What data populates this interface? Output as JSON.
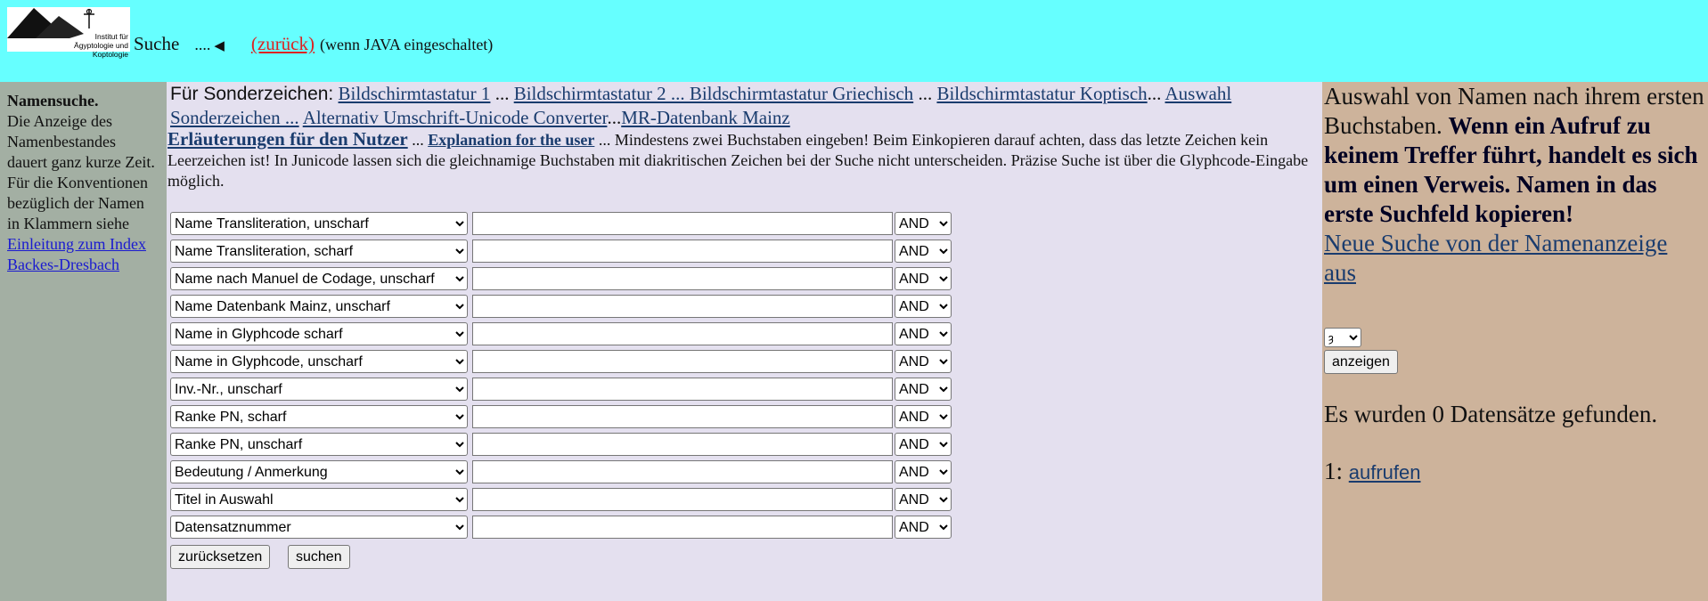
{
  "header": {
    "logo_text_line1": "Institut für",
    "logo_text_line2": "Ägyptologie und Koptologie",
    "title": "Suche",
    "dots": "....",
    "back_label": "(zurück)",
    "java_hint": "(wenn JAVA eingeschaltet)"
  },
  "sidebar": {
    "heading": "Namensuche.",
    "text1": "Die Anzeige des Namenbestandes dauert ganz kurze Zeit.",
    "text2": "Für die Konventionen bezüglich der Namen in Klammern siehe",
    "link": "Einleitung zum Index Backes-Dresbach"
  },
  "special_chars": {
    "label": "Für Sonderzeichen:",
    "links": [
      "Bildschirmtastatur 1",
      "Bildschirmtastatur 2 ... Bildschirmtastatur Griechisch",
      "Bildschirmtastatur Koptisch",
      "Auswahl Sonderzeichen ...",
      "Alternativ Umschrift-Unicode Converter",
      "MR-Datenbank Mainz"
    ],
    "sep1": "...",
    "sep2": "...",
    "sep3": "...",
    "sep4": "..."
  },
  "info": {
    "link_users": "Erläuterungen für den Nutzer",
    "sep": "...",
    "link_explanation": "Explanation for the user",
    "text": "... Mindestens zwei Buchstaben eingeben! Beim Einkopieren darauf achten, dass das letzte Zeichen kein Leerzeichen ist! In Junicode lassen sich die gleichnamige Buchstaben mit diakritischen Zeichen bei der Suche nicht unterscheiden. Präzise Suche ist über die Glyphcode-Eingabe möglich."
  },
  "search_rows": [
    {
      "field": "Name Transliteration, unscharf",
      "op": "AND"
    },
    {
      "field": "Name Transliteration, scharf",
      "op": "AND"
    },
    {
      "field": "Name nach Manuel de Codage, unscharf",
      "op": "AND"
    },
    {
      "field": "Name Datenbank Mainz, unscharf",
      "op": "AND"
    },
    {
      "field": "Name in Glyphcode scharf",
      "op": "AND"
    },
    {
      "field": "Name in Glyphcode, unscharf",
      "op": "AND"
    },
    {
      "field": "Inv.-Nr., unscharf",
      "op": "AND"
    },
    {
      "field": "Ranke PN, scharf",
      "op": "AND"
    },
    {
      "field": "Ranke PN, unscharf",
      "op": "AND"
    },
    {
      "field": "Bedeutung / Anmerkung",
      "op": "AND"
    },
    {
      "field": "Titel in Auswahl",
      "op": "AND"
    },
    {
      "field": "Datensatznummer",
      "op": "AND"
    }
  ],
  "buttons": {
    "reset": "zurücksetzen",
    "search": "suchen"
  },
  "right_panel": {
    "text_normal": "Auswahl von Namen nach ihrem ersten Buchstaben.",
    "text_bold": "Wenn ein Aufruf zu keinem Treffer führt, handelt es sich um einen Verweis. Namen in das erste Suchfeld kopieren!",
    "new_search_link": "Neue Suche von der Namenanzeige aus",
    "letter_value": "ȝ",
    "show_button": "anzeigen",
    "found_text": "Es wurden 0 Datensätze gefunden.",
    "result_number": "1:",
    "result_link": "aufrufen"
  }
}
